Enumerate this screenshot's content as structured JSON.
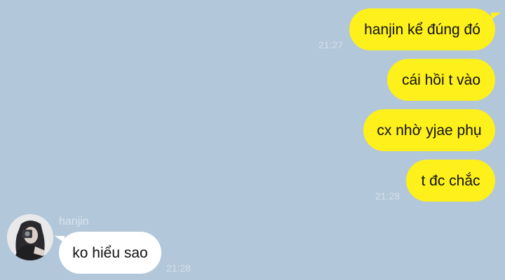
{
  "colors": {
    "background": "#b2c7da",
    "outgoing_bubble": "#fef01b",
    "incoming_bubble": "#ffffff",
    "timestamp": "#d5e0ea"
  },
  "messages": [
    {
      "direction": "outgoing",
      "text": "hanjin kể đúng đó"
    },
    {
      "direction": "outgoing",
      "text": "cái hồi t vào"
    },
    {
      "direction": "outgoing",
      "text": "cx nhờ yjae phụ"
    },
    {
      "direction": "outgoing",
      "text": "t đc chắc"
    },
    {
      "direction": "incoming",
      "sender": "hanjin",
      "text": "ko hiểu sao"
    }
  ],
  "timestamps": {
    "group1": "21:27",
    "group2": "21:28",
    "incoming": "21:28"
  },
  "icons": {
    "avatar": "profile-photo-avatar"
  }
}
